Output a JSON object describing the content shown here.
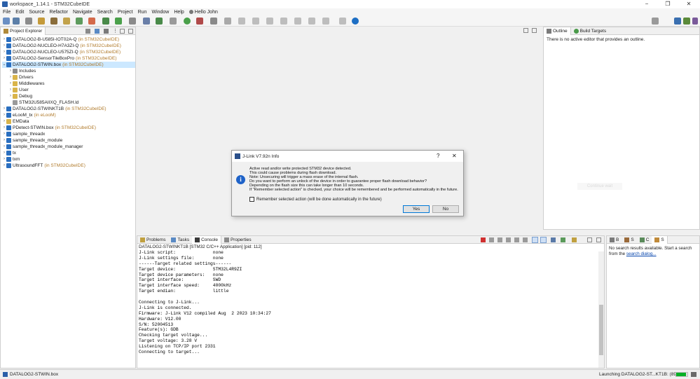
{
  "window": {
    "title": "workspace_1.14.1 - STM32CubeIDE",
    "minimize": "−",
    "restore": "❐",
    "close": "✕"
  },
  "menu": [
    "File",
    "Edit",
    "Source",
    "Refactor",
    "Navigate",
    "Search",
    "Project",
    "Run",
    "Window",
    "Help"
  ],
  "user": {
    "label": "Hello John"
  },
  "project_explorer": {
    "tab_label": "Project Explorer",
    "items": [
      {
        "indent": 0,
        "expanded": false,
        "name": "DATALOG2-B-U585I-IOT02A-Q",
        "annotation": "(in STM32CubeIDE)",
        "icon": "project-icon"
      },
      {
        "indent": 0,
        "expanded": false,
        "name": "DATALOG2-NUCLEO-H7A3ZI-Q",
        "annotation": "(in STM32CubeIDE)",
        "icon": "project-icon"
      },
      {
        "indent": 0,
        "expanded": false,
        "name": "DATALOG2-NUCLEO-U575ZI-Q",
        "annotation": "(in STM32CubeIDE)",
        "icon": "project-icon"
      },
      {
        "indent": 0,
        "expanded": false,
        "name": "DATALOG2-SensorTileBoxPro",
        "annotation": "(in STM32CubeIDE)",
        "icon": "project-icon"
      },
      {
        "indent": 0,
        "expanded": true,
        "name": "DATALOG2-STWIN.box",
        "annotation": "(in STM32CubeIDE)",
        "icon": "project-icon",
        "selected": true
      },
      {
        "indent": 1,
        "expanded": false,
        "name": "Includes",
        "annotation": "",
        "icon": "includes-icon"
      },
      {
        "indent": 1,
        "expanded": false,
        "name": "Drivers",
        "annotation": "",
        "icon": "folder-icon"
      },
      {
        "indent": 1,
        "expanded": false,
        "name": "Middlewares",
        "annotation": "",
        "icon": "folder-icon"
      },
      {
        "indent": 1,
        "expanded": false,
        "name": "User",
        "annotation": "",
        "icon": "folder-icon"
      },
      {
        "indent": 1,
        "expanded": false,
        "name": "Debug",
        "annotation": "",
        "icon": "folder-icon"
      },
      {
        "indent": 1,
        "expanded": null,
        "name": "STM32U585AIIXQ_FLASH.ld",
        "annotation": "",
        "icon": "file-icon"
      },
      {
        "indent": 0,
        "expanded": false,
        "name": "DATALOG2-STWINKT1B",
        "annotation": "(in STM32CubeIDE)",
        "icon": "project-icon"
      },
      {
        "indent": 0,
        "expanded": false,
        "name": "eLooM_tx",
        "annotation": "(in eLooM)",
        "icon": "project-icon"
      },
      {
        "indent": 0,
        "expanded": false,
        "name": "EMData",
        "annotation": "",
        "icon": "folder-icon"
      },
      {
        "indent": 0,
        "expanded": false,
        "name": "PDetect-STWIN.box",
        "annotation": "(in STM32CubeIDE)",
        "icon": "project-icon"
      },
      {
        "indent": 0,
        "expanded": false,
        "name": "sample_threadx",
        "annotation": "",
        "icon": "project-icon"
      },
      {
        "indent": 0,
        "expanded": false,
        "name": "sample_threadx_module",
        "annotation": "",
        "icon": "project-icon"
      },
      {
        "indent": 0,
        "expanded": false,
        "name": "sample_threadx_module_manager",
        "annotation": "",
        "icon": "project-icon"
      },
      {
        "indent": 0,
        "expanded": false,
        "name": "tx",
        "annotation": "",
        "icon": "project-icon"
      },
      {
        "indent": 0,
        "expanded": false,
        "name": "txm",
        "annotation": "",
        "icon": "project-icon"
      },
      {
        "indent": 0,
        "expanded": false,
        "name": "UltrasoundFFT",
        "annotation": "(in STM32CubeIDE)",
        "icon": "project-icon"
      }
    ]
  },
  "outline": {
    "tab_outline": "Outline",
    "tab_build": "Build Targets",
    "message": "There is no active editor that provides an outline."
  },
  "console": {
    "tabs": [
      "Problems",
      "Tasks",
      "Console",
      "Properties"
    ],
    "header": "DATALOG2-STWINKT1B [STM32 C/C++ Application]  [pid: 112]",
    "lines": [
      "J-Link script:              none",
      "J-Link settings file:       none",
      "------Target related settings------",
      "Target device:              STM32L4R9ZI",
      "Target device parameters:   none",
      "Target interface:           SWD",
      "Target interface speed:     4000kHz",
      "Target endian:              little",
      "",
      "Connecting to J-Link...",
      "J-Link is connected.",
      "Firmware: J-Link V12 compiled Aug  2 2023 10:34:27",
      "Hardware: V12.00",
      "S/N: 52004513",
      "Feature(s): GDB",
      "Checking target voltage...",
      "Target voltage: 3.28 V",
      "Listening on TCP/IP port 2331",
      "Connecting to target..."
    ]
  },
  "search_panel": {
    "tabs": [
      "B",
      "S",
      "C",
      "S"
    ],
    "message_prefix": "No search results available. Start a search from the ",
    "link": "search dialog...",
    "ghost_button": "Continue wait"
  },
  "dialog": {
    "title": "J-Link V7.92n Info",
    "help": "?",
    "close": "✕",
    "lines": [
      "Active read and/or write protected STM32 device detected.",
      "This could cause problems during flash download.",
      "Note: Unsecuring will trigger a mass erase of the internal flash.",
      "Do you want to perform an unlock of the device in order to guarantee proper flash download behavior?",
      "Depending on the flash size this can take longer than 10 seconds.",
      "If \"Remember selected action\" is checked, your choice will be remembered and be performed automatically in the future."
    ],
    "checkbox_label": "Remember selected action (will be done automatically in the future)",
    "yes": "Yes",
    "no": "No"
  },
  "status": {
    "selected": "DATALOG2-STWIN.box",
    "progress_label": "Launching DATALOG2-ST...KT1B: (89%)",
    "progress": 0.89
  },
  "colors": {
    "accent": "#0078d7",
    "annotation": "#b07a2a",
    "link": "#0645ad"
  }
}
